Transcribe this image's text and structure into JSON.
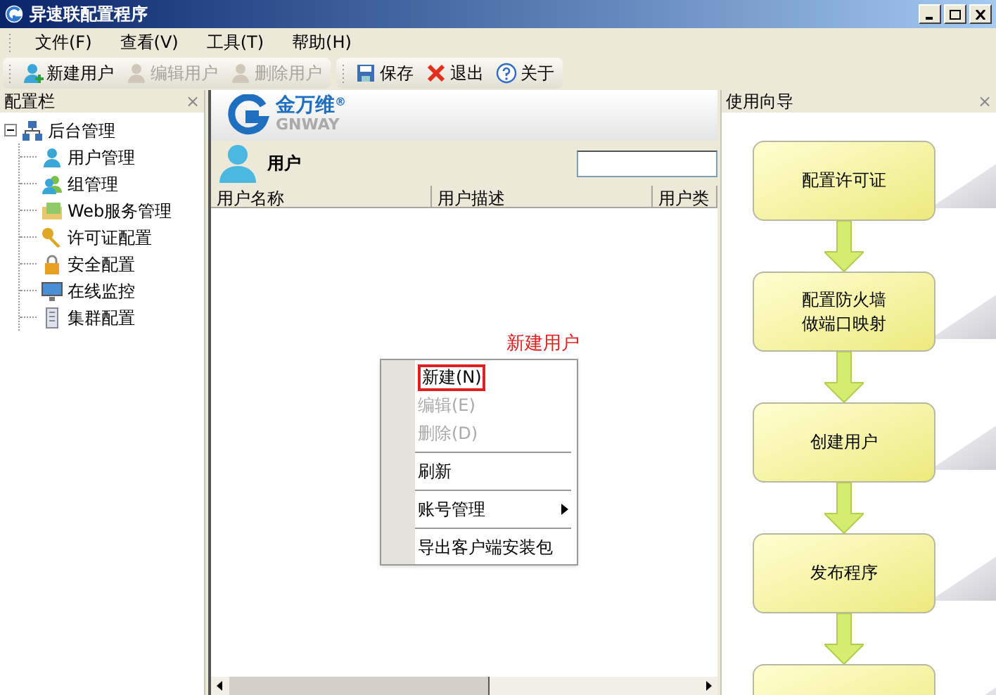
{
  "window": {
    "title": "异速联配置程序"
  },
  "menu": [
    "文件(F)",
    "查看(V)",
    "工具(T)",
    "帮助(H)"
  ],
  "toolbars": [
    {
      "buttons": [
        {
          "label": "新建用户",
          "disabled": false
        },
        {
          "label": "编辑用户",
          "disabled": true
        },
        {
          "label": "删除用户",
          "disabled": true
        }
      ]
    },
    {
      "buttons": [
        {
          "label": "保存",
          "disabled": false
        },
        {
          "label": "退出",
          "disabled": false
        },
        {
          "label": "关于",
          "disabled": false
        }
      ]
    }
  ],
  "sidebar": {
    "title": "配置栏",
    "close": "×",
    "tree": {
      "label": "后台管理",
      "expanded": true,
      "children": [
        {
          "label": "用户管理"
        },
        {
          "label": "组管理"
        },
        {
          "label": "Web服务管理"
        },
        {
          "label": "许可证配置"
        },
        {
          "label": "安全配置"
        },
        {
          "label": "在线监控"
        },
        {
          "label": "集群配置"
        }
      ]
    }
  },
  "main": {
    "logo": {
      "name": "金万维",
      "latin": "GNWAY",
      "mark": "®"
    },
    "section": "用户",
    "columns": [
      "用户名称",
      "用户描述",
      "用户类"
    ]
  },
  "context_menu": {
    "items": [
      {
        "kind": "item",
        "label": "新建(N)",
        "disabled": false,
        "highlighted": true
      },
      {
        "kind": "item",
        "label": "编辑(E)",
        "disabled": true,
        "highlighted": false
      },
      {
        "kind": "item",
        "label": "删除(D)",
        "disabled": true,
        "highlighted": false
      },
      {
        "kind": "separator"
      },
      {
        "kind": "item",
        "label": "刷新",
        "disabled": false,
        "highlighted": false
      },
      {
        "kind": "separator"
      },
      {
        "kind": "submenu",
        "label": "账号管理",
        "disabled": false,
        "highlighted": false
      },
      {
        "kind": "separator"
      },
      {
        "kind": "item",
        "label": "导出客户端安装包",
        "disabled": false,
        "highlighted": false
      }
    ],
    "annotation": "新建用户"
  },
  "guide": {
    "title": "使用向导",
    "close": "×",
    "steps": [
      {
        "label": "配置许可证"
      },
      {
        "label": "配置防火墙做端口映射"
      },
      {
        "label": "创建用户"
      },
      {
        "label": "发布程序"
      }
    ]
  }
}
